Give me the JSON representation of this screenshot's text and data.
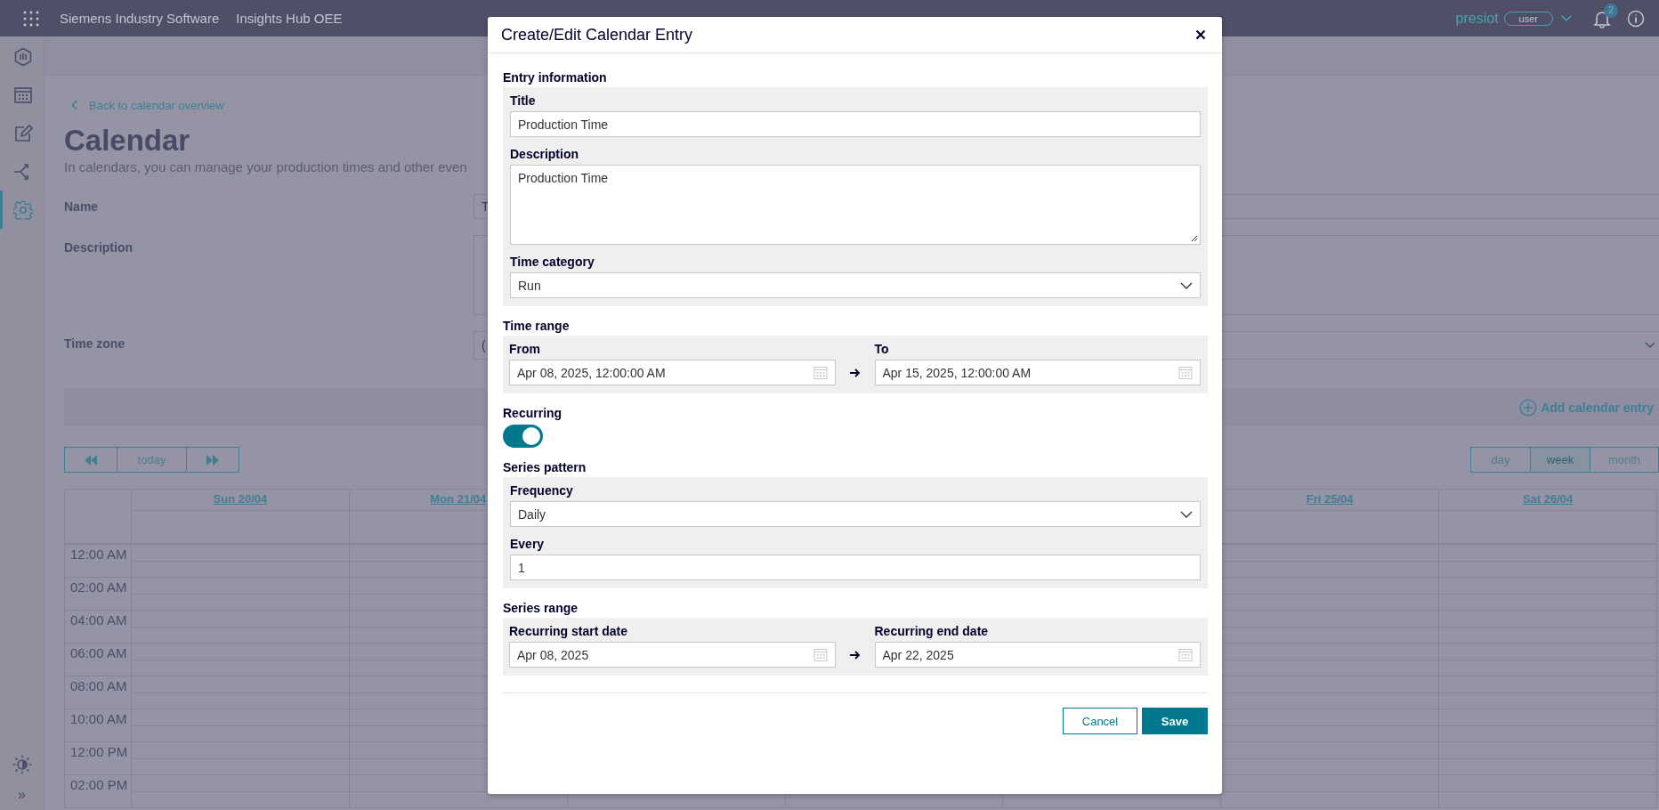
{
  "header": {
    "brand": "Siemens Industry Software",
    "app": "Insights Hub OEE",
    "user": "presiot",
    "role": "user",
    "notifications": "2"
  },
  "sidebar": {
    "items": [
      {
        "kind": "gauge",
        "selected": false
      },
      {
        "kind": "calendar",
        "selected": false
      },
      {
        "kind": "edit",
        "selected": false
      },
      {
        "kind": "share",
        "selected": false
      },
      {
        "kind": "settings",
        "selected": true
      }
    ],
    "expand": "»"
  },
  "page": {
    "back_link": "Back to calendar overview",
    "title": "Calendar",
    "subtitle": "In calendars, you can manage your production times and other even",
    "form": [
      {
        "label": "Name",
        "kind": "text",
        "value": "T"
      },
      {
        "label": "Description",
        "kind": "textarea"
      },
      {
        "label": "Time zone",
        "kind": "select",
        "value": "("
      }
    ],
    "add_entry": "Add calendar entry",
    "today": "today",
    "views": [
      {
        "label": "day",
        "selected": false
      },
      {
        "label": "week",
        "selected": true
      },
      {
        "label": "month",
        "selected": false
      }
    ],
    "days_left": [
      "Sun 20/04",
      "Mon 21/04"
    ],
    "days_right": [
      "Fri 25/04",
      "Sat 26/04"
    ],
    "times": [
      "12:00 AM",
      "02:00 AM",
      "04:00 AM",
      "06:00 AM",
      "08:00 AM",
      "10:00 AM",
      "12:00 PM",
      "02:00 PM"
    ]
  },
  "dialog": {
    "title": "Create/Edit Calendar Entry",
    "sections": [
      {
        "heading": "Entry information",
        "kind": "panel",
        "fields": [
          {
            "label": "Title",
            "kind": "text",
            "value": "Production Time"
          },
          {
            "label": "Description",
            "kind": "textarea",
            "value": "Production Time"
          },
          {
            "label": "Time category",
            "kind": "select",
            "value": "Run"
          }
        ]
      },
      {
        "heading": "Time range",
        "kind": "range",
        "fields": [
          {
            "label": "From",
            "kind": "date",
            "value": "Apr 08, 2025, 12:00:00 AM"
          },
          {
            "label": "To",
            "kind": "date",
            "value": "Apr 15, 2025, 12:00:00 AM"
          }
        ]
      },
      {
        "heading": "Recurring",
        "kind": "toggle",
        "on": true
      },
      {
        "heading": "Series pattern",
        "kind": "panel",
        "fields": [
          {
            "label": "Frequency",
            "kind": "select",
            "value": "Daily"
          },
          {
            "label": "Every",
            "kind": "text",
            "value": "1"
          }
        ]
      },
      {
        "heading": "Series range",
        "kind": "range",
        "fields": [
          {
            "label": "Recurring start date",
            "kind": "date",
            "value": "Apr 08, 2025"
          },
          {
            "label": "Recurring end date",
            "kind": "date",
            "value": "Apr 22, 2025"
          }
        ]
      }
    ],
    "buttons": [
      {
        "label": "Cancel",
        "kind": "secondary"
      },
      {
        "label": "Save",
        "kind": "primary"
      }
    ]
  }
}
